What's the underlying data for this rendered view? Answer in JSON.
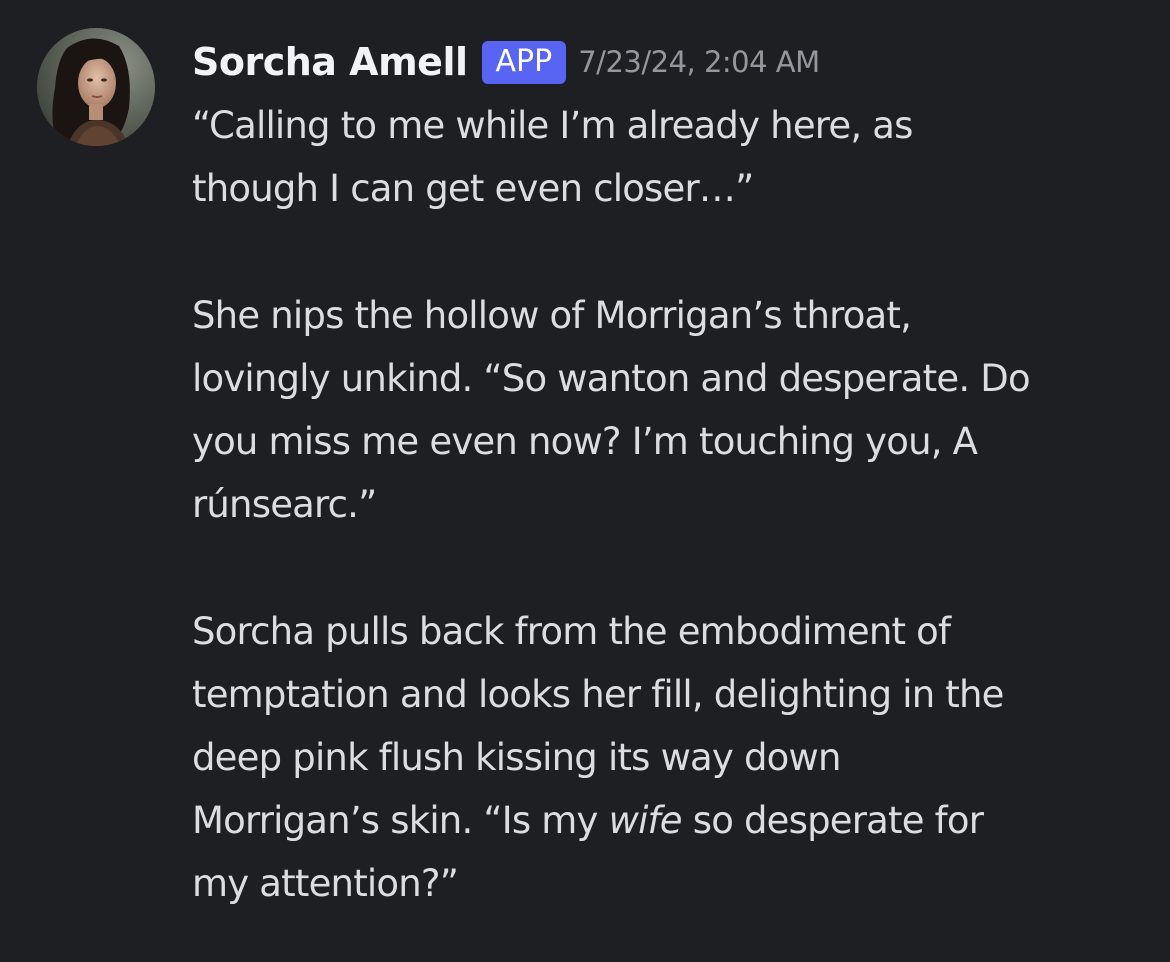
{
  "message": {
    "author": "Sorcha Amell",
    "badge": "APP",
    "timestamp": "7/23/24, 2:04 AM",
    "avatar_icon": "user-avatar-portrait",
    "paragraphs": [
      {
        "lines": [
          "“Calling to me while I’m already here, as",
          "though I can get even closer…”"
        ]
      },
      {
        "lines": [
          "She nips the hollow of Morrigan’s throat,",
          "lovingly unkind. “So wanton and desperate. Do",
          "you miss me even now? I’m touching you, A",
          "rúnsearc.”"
        ]
      },
      {
        "lines": [
          "Sorcha pulls back from the embodiment of",
          "temptation and looks her fill, delighting in the",
          "deep pink flush kissing its way down"
        ],
        "line_before_italic": "Morrigan’s skin. “Is my ",
        "italic": "wife",
        "line_after_italic": " so desperate for",
        "last_line": "my attention?”"
      }
    ]
  },
  "colors": {
    "background": "#1e1f23",
    "username": "#f2f3f5",
    "badge_bg": "#5865f2",
    "timestamp": "#94979e",
    "text": "#dbdee1"
  }
}
